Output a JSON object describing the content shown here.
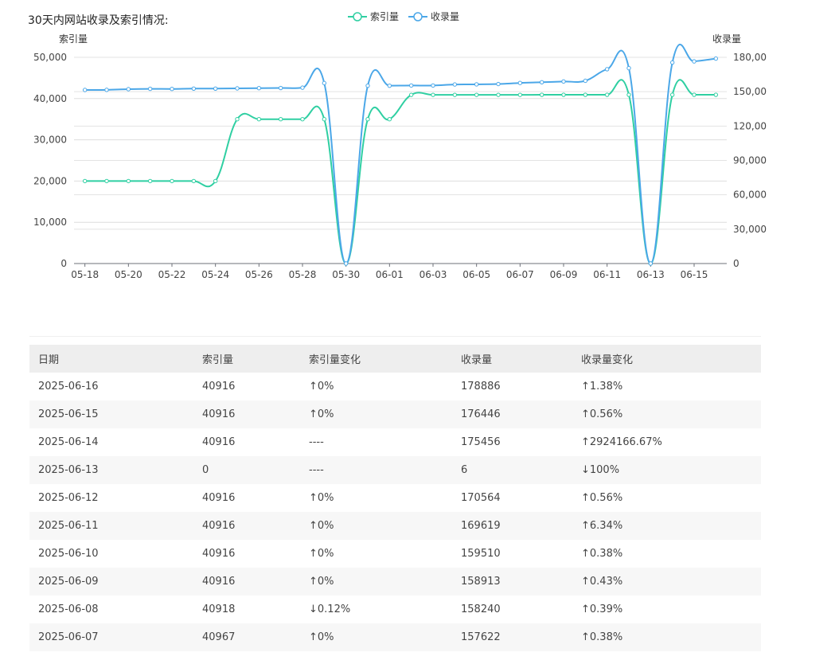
{
  "title": "30天内网站收录及索引情况:",
  "chart_data": {
    "type": "line",
    "x": [
      "05-18",
      "05-19",
      "05-20",
      "05-21",
      "05-22",
      "05-23",
      "05-24",
      "05-25",
      "05-26",
      "05-27",
      "05-28",
      "05-29",
      "05-30",
      "05-31",
      "06-01",
      "06-02",
      "06-03",
      "06-04",
      "06-05",
      "06-06",
      "06-07",
      "06-08",
      "06-09",
      "06-10",
      "06-11",
      "06-12",
      "06-13",
      "06-14",
      "06-15",
      "06-16"
    ],
    "x_tick_labels": [
      "05-18",
      "05-20",
      "05-22",
      "05-24",
      "05-26",
      "05-28",
      "05-30",
      "06-01",
      "06-03",
      "06-05",
      "06-07",
      "06-09",
      "06-11",
      "06-13",
      "06-15"
    ],
    "series": [
      {
        "name": "索引量",
        "axis": "left",
        "color": "#2fcfa2",
        "values": [
          20000,
          20000,
          20000,
          20000,
          20000,
          20000,
          20000,
          35000,
          35000,
          35000,
          35000,
          35000,
          0,
          35000,
          35000,
          40900,
          40900,
          40900,
          40900,
          40900,
          40900,
          40918,
          40916,
          40916,
          40916,
          40916,
          0,
          40916,
          40916,
          40916
        ]
      },
      {
        "name": "收录量",
        "axis": "right",
        "color": "#4ba7e8",
        "values": [
          151500,
          151600,
          152200,
          152500,
          152400,
          152700,
          152700,
          152900,
          153100,
          153200,
          153500,
          157500,
          0,
          155200,
          155200,
          155400,
          155400,
          156300,
          156400,
          156700,
          157622,
          158240,
          158913,
          159510,
          169619,
          170564,
          6,
          175456,
          176446,
          178886
        ]
      }
    ],
    "y_left": {
      "label": "索引量",
      "range": [
        0,
        50000
      ],
      "ticks": [
        "0",
        "10,000",
        "20,000",
        "30,000",
        "40,000",
        "50,000"
      ]
    },
    "y_right": {
      "label": "收录量",
      "range": [
        0,
        180000
      ],
      "ticks": [
        "0",
        "30,000",
        "60,000",
        "90,000",
        "120,00",
        "150,00",
        "180,00"
      ]
    },
    "grid": true,
    "legend": "top-center"
  },
  "table": {
    "headers": [
      "日期",
      "索引量",
      "索引量变化",
      "收录量",
      "收录量变化"
    ],
    "rows": [
      {
        "date": "2025-06-16",
        "index": "40916",
        "index_change": "↑0%",
        "index_dir": "up",
        "included": "178886",
        "included_change": "↑1.38%",
        "included_dir": "up"
      },
      {
        "date": "2025-06-15",
        "index": "40916",
        "index_change": "↑0%",
        "index_dir": "up",
        "included": "176446",
        "included_change": "↑0.56%",
        "included_dir": "up"
      },
      {
        "date": "2025-06-14",
        "index": "40916",
        "index_change": "----",
        "index_dir": "none",
        "included": "175456",
        "included_change": "↑2924166.67%",
        "included_dir": "up"
      },
      {
        "date": "2025-06-13",
        "index": "0",
        "index_change": "----",
        "index_dir": "none",
        "included": "6",
        "included_change": "↓100%",
        "included_dir": "down"
      },
      {
        "date": "2025-06-12",
        "index": "40916",
        "index_change": "↑0%",
        "index_dir": "up",
        "included": "170564",
        "included_change": "↑0.56%",
        "included_dir": "up"
      },
      {
        "date": "2025-06-11",
        "index": "40916",
        "index_change": "↑0%",
        "index_dir": "up",
        "included": "169619",
        "included_change": "↑6.34%",
        "included_dir": "up"
      },
      {
        "date": "2025-06-10",
        "index": "40916",
        "index_change": "↑0%",
        "index_dir": "up",
        "included": "159510",
        "included_change": "↑0.38%",
        "included_dir": "up"
      },
      {
        "date": "2025-06-09",
        "index": "40916",
        "index_change": "↑0%",
        "index_dir": "up",
        "included": "158913",
        "included_change": "↑0.43%",
        "included_dir": "up"
      },
      {
        "date": "2025-06-08",
        "index": "40918",
        "index_change": "↓0.12%",
        "index_dir": "down",
        "included": "158240",
        "included_change": "↑0.39%",
        "included_dir": "up"
      },
      {
        "date": "2025-06-07",
        "index": "40967",
        "index_change": "↑0%",
        "index_dir": "up",
        "included": "157622",
        "included_change": "↑0.38%",
        "included_dir": "up"
      }
    ]
  }
}
